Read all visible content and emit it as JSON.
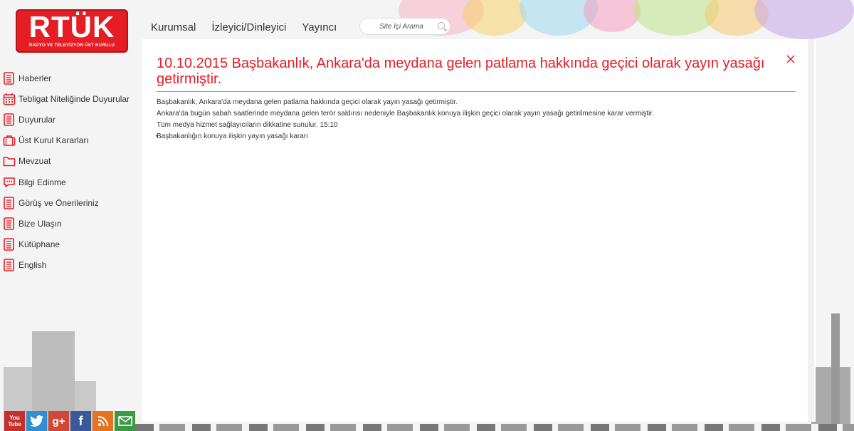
{
  "header": {
    "logo_main": "RTÜK",
    "logo_sub": "RADYO VE TELEVİZYON ÜST KURULU",
    "nav": [
      "Kurumsal",
      "İzleyici/Dinleyici",
      "Yayıncı"
    ],
    "search_placeholder": "Site İçi Arama"
  },
  "sidebar": {
    "items": [
      {
        "label": "Haberler",
        "icon": "document-icon"
      },
      {
        "label": "Tebligat Niteliğinde Duyurular",
        "icon": "calendar-icon"
      },
      {
        "label": "Duyurular",
        "icon": "document-icon"
      },
      {
        "label": "Üst Kurul Kararları",
        "icon": "briefcase-icon"
      },
      {
        "label": "Mevzuat",
        "icon": "folder-icon"
      },
      {
        "label": "Bilgi Edinme",
        "icon": "chat-bubble-icon"
      },
      {
        "label": "Görüş ve Önerileriniz",
        "icon": "document-icon"
      },
      {
        "label": "Bize Ulaşın",
        "icon": "document-icon"
      },
      {
        "label": "Kütüphane",
        "icon": "document-icon"
      },
      {
        "label": "English",
        "icon": "document-icon"
      }
    ]
  },
  "article": {
    "title": "10.10.2015 Başbakanlık, Ankara'da meydana gelen patlama hakkında geçici olarak yayın yasağı getirmiştir.",
    "paragraphs": [
      "Başbakanlık, Ankara'da meydana gelen patlama hakkında geçici olarak yayın yasağı getirmiştir.",
      "Ankara'da bugün sabah saatlerinde meydana gelen terör saldırısı nedeniyle Başbakanlık konuya ilişkin geçici olarak yayın yasağı getirilmesine karar vermiştir.",
      "Tüm medya hizmet sağlayıcıların dikkatine sunulur. 15:10"
    ],
    "link": "Başbakanlığın konuya ilişkin yayın yasağı kararı"
  },
  "social": [
    {
      "name": "youtube",
      "label": "You Tube",
      "color": "#c4302b"
    },
    {
      "name": "twitter",
      "label": "t",
      "color": "#2f8fd0"
    },
    {
      "name": "google-plus",
      "label": "g+",
      "color": "#d14836"
    },
    {
      "name": "facebook",
      "label": "f",
      "color": "#3b5998"
    },
    {
      "name": "rss",
      "label": "rss",
      "color": "#e8731e"
    },
    {
      "name": "mail",
      "label": "mail",
      "color": "#3b9a43"
    }
  ],
  "colors": {
    "accent": "#e51d24"
  }
}
